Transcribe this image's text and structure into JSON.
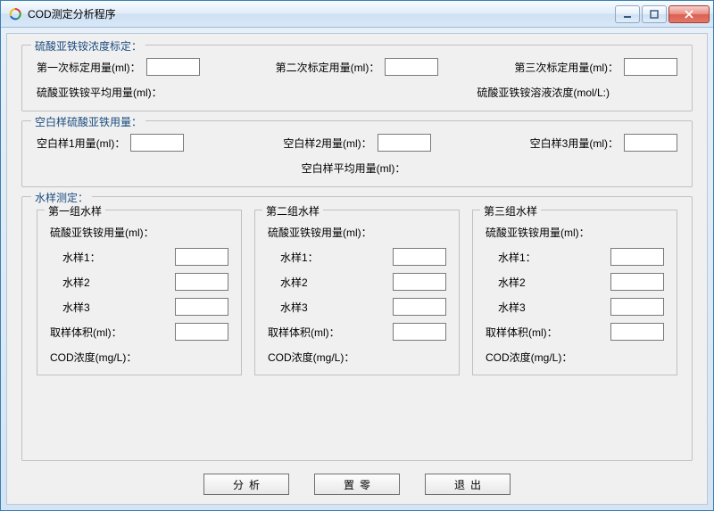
{
  "window": {
    "title": "COD测定分析程序"
  },
  "group_calibration": {
    "legend": "硫酸亚铁铵浓度标定：",
    "cal1_label": "第一次标定用量(ml)：",
    "cal2_label": "第二次标定用量(ml)：",
    "cal3_label": "第三次标定用量(ml)：",
    "avg_label": "硫酸亚铁铵平均用量(ml)：",
    "conc_label": "硫酸亚铁铵溶液浓度(mol/L:)",
    "cal1_value": "",
    "cal2_value": "",
    "cal3_value": "",
    "avg_value": "",
    "conc_value": ""
  },
  "group_blank": {
    "legend": "空白样硫酸亚铁用量：",
    "b1_label": "空白样1用量(ml)：",
    "b2_label": "空白样2用量(ml)：",
    "b3_label": "空白样3用量(ml)：",
    "avg_label": "空白样平均用量(ml)：",
    "b1_value": "",
    "b2_value": "",
    "b3_value": "",
    "avg_value": ""
  },
  "group_sample": {
    "legend": "水样测定：",
    "groups": [
      {
        "legend": "第一组水样",
        "usage_label": "硫酸亚铁铵用量(ml)：",
        "s1_label": "水样1：",
        "s1_value": "",
        "s2_label": "水样2",
        "s2_value": "",
        "s3_label": "水样3",
        "s3_value": "",
        "vol_label": "取样体积(ml)：",
        "vol_value": "",
        "cod_label": "COD浓度(mg/L)：",
        "cod_value": ""
      },
      {
        "legend": "第二组水样",
        "usage_label": "硫酸亚铁铵用量(ml)：",
        "s1_label": "水样1：",
        "s1_value": "",
        "s2_label": "水样2",
        "s2_value": "",
        "s3_label": "水样3",
        "s3_value": "",
        "vol_label": "取样体积(ml)：",
        "vol_value": "",
        "cod_label": "COD浓度(mg/L)：",
        "cod_value": ""
      },
      {
        "legend": "第三组水样",
        "usage_label": "硫酸亚铁铵用量(ml)：",
        "s1_label": "水样1：",
        "s1_value": "",
        "s2_label": "水样2",
        "s2_value": "",
        "s3_label": "水样3",
        "s3_value": "",
        "vol_label": "取样体积(ml)：",
        "vol_value": "",
        "cod_label": "COD浓度(mg/L)：",
        "cod_value": ""
      }
    ]
  },
  "buttons": {
    "analyze": "分析",
    "reset": "置零",
    "exit": "退出"
  }
}
